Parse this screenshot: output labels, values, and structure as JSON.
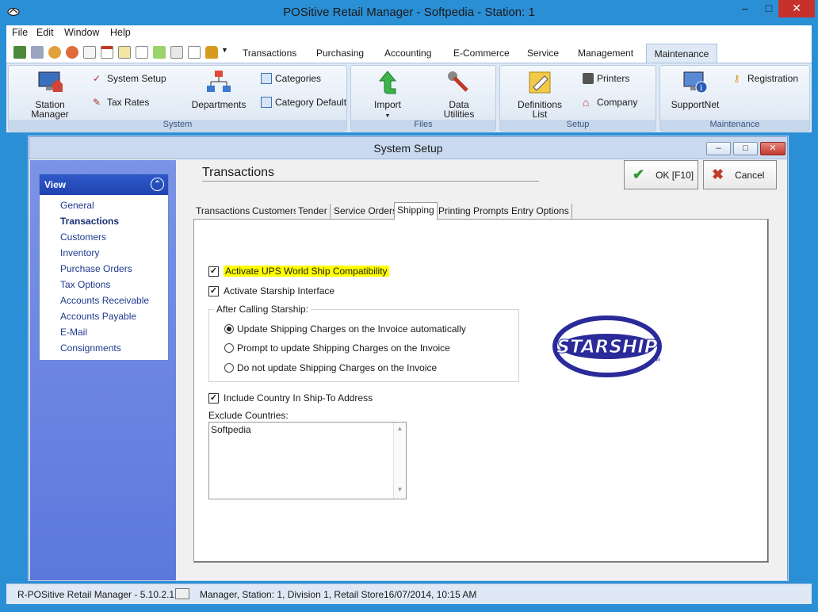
{
  "window": {
    "title": "POSitive Retail Manager - Softpedia - Station: 1"
  },
  "menu": [
    "File",
    "Edit",
    "Window",
    "Help"
  ],
  "ribbon_tabs": [
    "Transactions",
    "Purchasing",
    "Accounting",
    "E-Commerce",
    "Service",
    "Management",
    "Maintenance"
  ],
  "ribbon": {
    "system": {
      "label": "System",
      "station_manager": "Station\nManager",
      "system_setup": "System Setup",
      "tax_rates": "Tax Rates",
      "departments": "Departments",
      "categories": "Categories",
      "category_default": "Category Default"
    },
    "files": {
      "label": "Files",
      "import": "Import",
      "data_utilities": "Data\nUtilities"
    },
    "setup": {
      "label": "Setup",
      "definitions_list": "Definitions\nList",
      "printers": "Printers",
      "company": "Company"
    },
    "maintenance": {
      "label": "Maintenance",
      "supportnet": "SupportNet",
      "registration": "Registration"
    }
  },
  "dialog": {
    "title": "System Setup",
    "nav_header": "View",
    "nav_items": [
      "General",
      "Transactions",
      "Customers",
      "Inventory",
      "Purchase Orders",
      "Tax Options",
      "Accounts Receivable",
      "Accounts Payable",
      "E-Mail",
      "Consignments"
    ],
    "section_title": "Transactions",
    "ok_label": "OK [F10]",
    "cancel_label": "Cancel",
    "tabs": [
      "Transactions",
      "Customers",
      "Tender",
      "Service Orders",
      "Shipping",
      "Printing",
      "Prompts",
      "Entry Options"
    ],
    "shipping": {
      "cb_ups": "Activate UPS World Ship Compatibility",
      "cb_starship": "Activate Starship Interface",
      "group_label": "After Calling Starship:",
      "radio_auto": "Update Shipping Charges on the Invoice automatically",
      "radio_prompt": "Prompt to update Shipping Charges on the Invoice",
      "radio_none": "Do not update Shipping Charges on the Invoice",
      "cb_country": "Include Country In Ship-To Address",
      "exclude_label": "Exclude Countries:",
      "exclude_value": "Softpedia",
      "logo_text": "STARSHIP",
      "logo_tm": "TM"
    }
  },
  "status": {
    "app_version": "R-POSitive Retail Manager - 5.10.2.1",
    "info": "Manager, Station: 1, Division 1, Retail Store",
    "datetime": "16/07/2014, 10:15 AM"
  }
}
